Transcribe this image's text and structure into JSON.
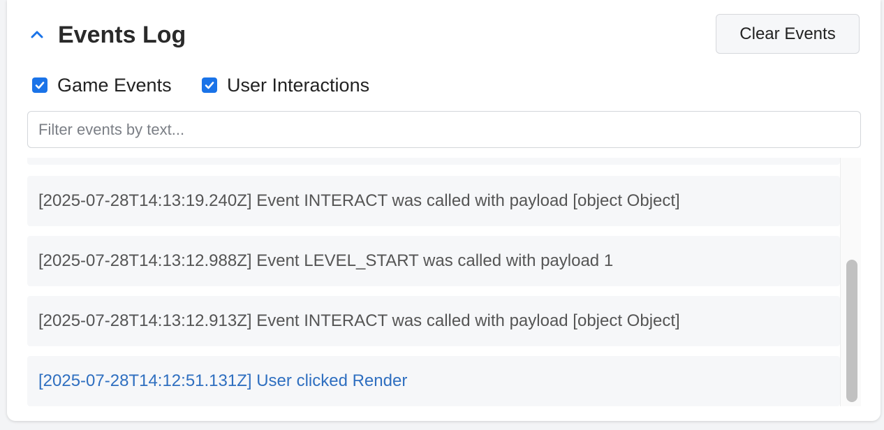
{
  "panel": {
    "title": "Events Log",
    "collapse_icon": "chevron-up-icon",
    "clear_button_label": "Clear Events"
  },
  "filters": {
    "game_events": {
      "label": "Game Events",
      "checked": true
    },
    "user_interactions": {
      "label": "User Interactions",
      "checked": true
    }
  },
  "search": {
    "placeholder": "Filter events by text...",
    "value": ""
  },
  "events": [
    {
      "text": "",
      "type": "game"
    },
    {
      "text": "[2025-07-28T14:13:19.240Z] Event INTERACT was called with payload [object Object]",
      "type": "game"
    },
    {
      "text": "[2025-07-28T14:13:12.988Z] Event LEVEL_START was called with payload 1",
      "type": "game"
    },
    {
      "text": "[2025-07-28T14:13:12.913Z] Event INTERACT was called with payload [object Object]",
      "type": "game"
    },
    {
      "text": "[2025-07-28T14:12:51.131Z] User clicked Render",
      "type": "user"
    }
  ],
  "colors": {
    "accent": "#1a73e8",
    "user_event_text": "#2f6fc0",
    "game_event_text": "#555555",
    "item_background": "#f6f7f9"
  }
}
